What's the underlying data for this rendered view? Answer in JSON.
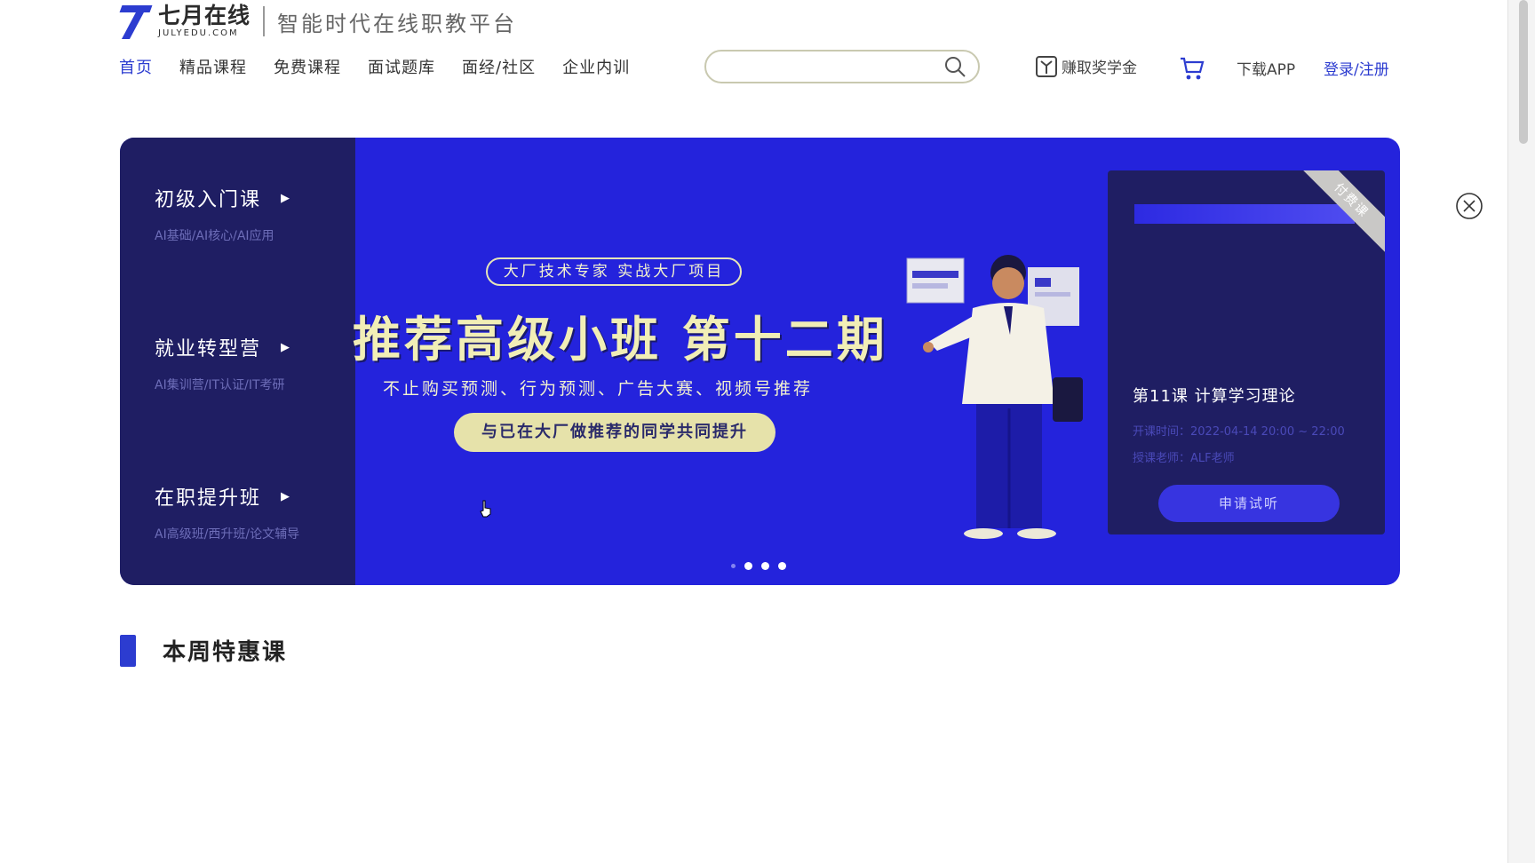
{
  "brand": {
    "logo_cn": "七月在线",
    "logo_en": "JULYEDU.COM",
    "slogan": "智能时代在线职教平台",
    "color": "#2c3cd0"
  },
  "nav": {
    "items": [
      {
        "label": "首页",
        "active": true
      },
      {
        "label": "精品课程"
      },
      {
        "label": "免费课程"
      },
      {
        "label": "面试题库"
      },
      {
        "label": "面经/社区"
      },
      {
        "label": "企业内训"
      }
    ]
  },
  "search": {
    "placeholder": "",
    "value": "",
    "icon": "search-icon"
  },
  "header_actions": {
    "reward_label": "赚取奖学金",
    "download_label": "下载APP",
    "login_label": "登录/注册"
  },
  "banner": {
    "categories": [
      {
        "title": "初级入门课",
        "sub": "AI基础/AI核心/AI应用"
      },
      {
        "title": "就业转型营",
        "sub": "AI集训营/IT认证/IT考研"
      },
      {
        "title": "在职提升班",
        "sub": "AI高级班/西升班/论文辅导"
      }
    ],
    "tag": "大厂技术专家 实战大厂项目",
    "headline": "推荐高级小班 第十二期",
    "subline": "不止购买预测、行为预测、广告大赛、视频号推荐",
    "pill": "与已在大厂做推荐的同学共同提升",
    "colors": {
      "bg": "#2423dc",
      "side": "#1f1e63",
      "headline": "#f1eeb6"
    }
  },
  "course_card": {
    "ribbon": "付费课",
    "title": "第11课 计算学习理论",
    "time_line": "开课时间：2022-04-14 20:00 ~ 22:00",
    "teacher_line": "授课老师：ALF老师",
    "button": "申请试听"
  },
  "carousel": {
    "count": 4,
    "active": 1
  },
  "section": {
    "title": "本周特惠课"
  }
}
